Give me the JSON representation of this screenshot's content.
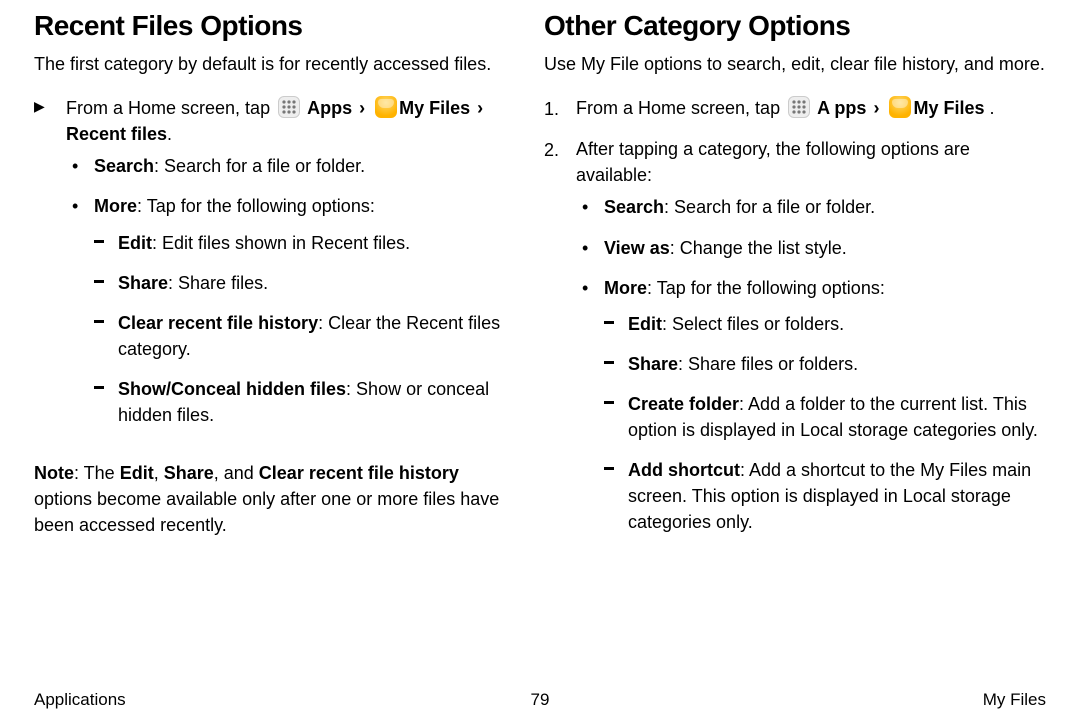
{
  "left": {
    "heading": "Recent Files Options",
    "intro": "The first category by default is for recently accessed files.",
    "step1": {
      "pre": "From a Home screen, tap ",
      "apps": "Apps",
      "chev1": "›",
      "myfiles": "My Files",
      "chev2": "›",
      "recent": "Recent files",
      "period": "."
    },
    "bullets": {
      "search_label": "Search",
      "search_text": ": Search for a file or folder.",
      "more_label": "More",
      "more_text": ": Tap for the following options:",
      "edit_label": "Edit",
      "edit_text": ": Edit files shown in Recent files.",
      "share_label": "Share",
      "share_text": ": Share files.",
      "clear_label": "Clear recent file history",
      "clear_text": ": Clear the Recent files category.",
      "show_label": "Show/Conceal hidden files",
      "show_text": ": Show or conceal hidden files."
    },
    "note": {
      "note_label": "Note",
      "t1": ": The ",
      "e": "Edit",
      "t2": ", ",
      "s": "Share",
      "t3": ", and ",
      "c": "Clear recent file history",
      "t4": " options become available only after one or more files have been accessed recently."
    }
  },
  "right": {
    "heading": "Other Category Options",
    "intro": "Use My File options to search, edit, clear file history, and more.",
    "step1": {
      "num": "1.",
      "pre": "From a Home screen, tap ",
      "apps": "A pps",
      "chev1": "›",
      "myfiles": "My Files ",
      "period": "."
    },
    "step2": {
      "num": "2.",
      "text": "After tapping a category, the following options are available:"
    },
    "bullets": {
      "search_label": "Search",
      "search_text": ": Search for a file or folder.",
      "view_label": "View as",
      "view_text": ": Change the list style.",
      "more_label": "More",
      "more_text": ": Tap for the following options:",
      "edit_label": "Edit",
      "edit_text": ": Select files or folders.",
      "share_label": "Share",
      "share_text": ": Share files or folders.",
      "create_label": "Create folder",
      "create_text": ": Add a folder to the current list. This option is displayed in Local storage categories only.",
      "shortcut_label": "Add shortcut",
      "shortcut_text": ": Add a shortcut to the My Files main screen. This option is displayed in Local storage categories only."
    }
  },
  "footer": {
    "left": "Applications",
    "center": "79",
    "right": "My Files"
  }
}
